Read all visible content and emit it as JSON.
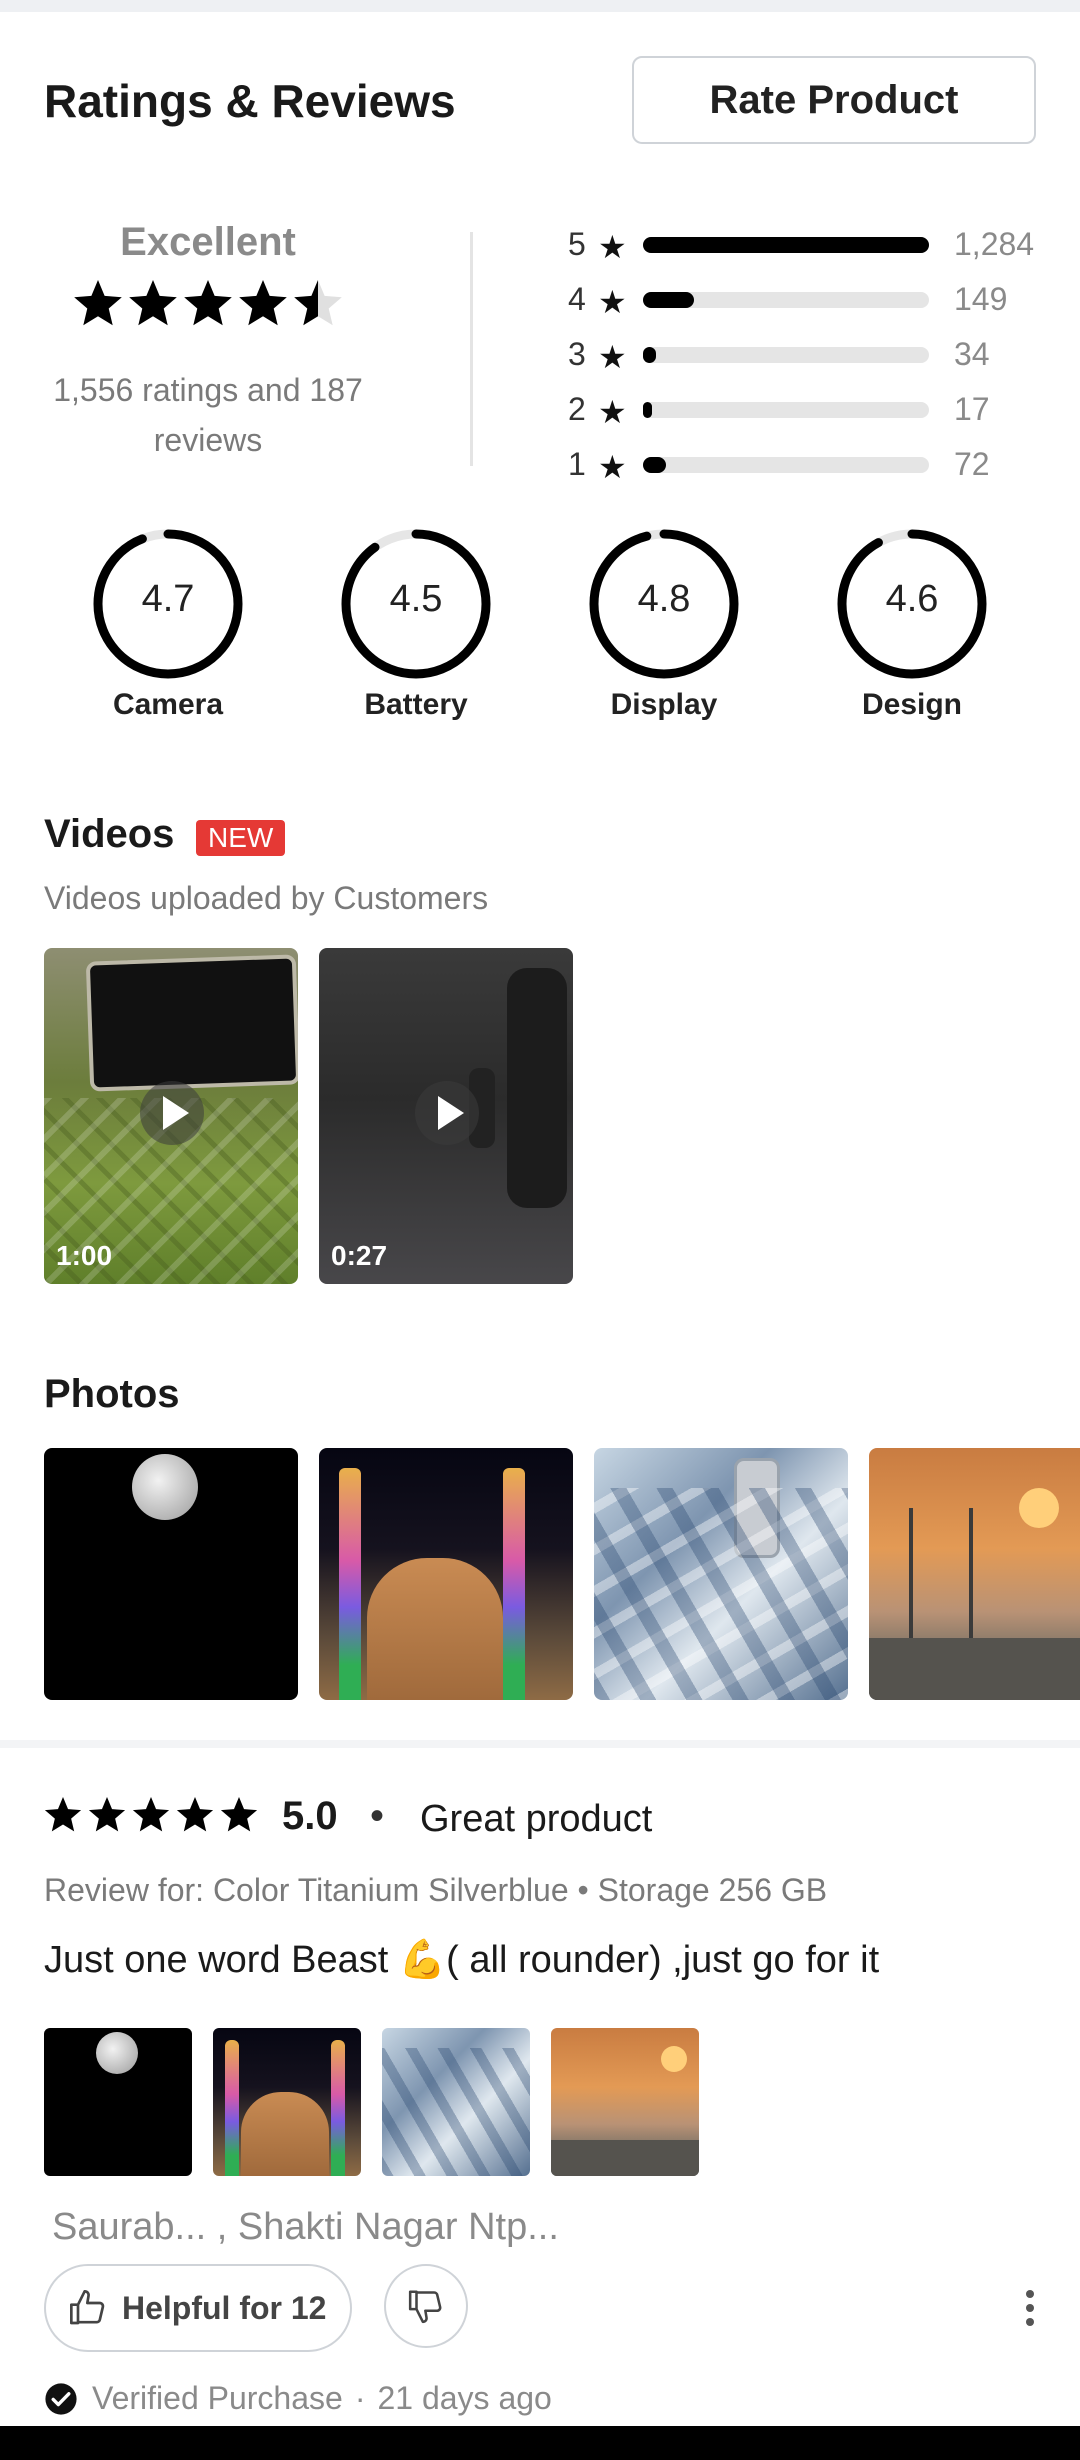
{
  "header": {
    "title": "Ratings & Reviews",
    "rate_button": "Rate Product"
  },
  "summary": {
    "label": "Excellent",
    "rating": 4.5,
    "count_text": "1,556 ratings and 187 reviews"
  },
  "distribution": [
    {
      "stars": "5",
      "count": "1,284",
      "fraction": 1.0
    },
    {
      "stars": "4",
      "count": "149",
      "fraction": 0.18
    },
    {
      "stars": "3",
      "count": "34",
      "fraction": 0.045
    },
    {
      "stars": "2",
      "count": "17",
      "fraction": 0.03
    },
    {
      "stars": "1",
      "count": "72",
      "fraction": 0.08
    }
  ],
  "star_glyph": "★",
  "aspects": [
    {
      "label": "Camera",
      "value": "4.7",
      "fraction": 0.94
    },
    {
      "label": "Battery",
      "value": "4.5",
      "fraction": 0.9
    },
    {
      "label": "Display",
      "value": "4.8",
      "fraction": 0.96
    },
    {
      "label": "Design",
      "value": "4.6",
      "fraction": 0.92
    }
  ],
  "videos": {
    "title": "Videos",
    "badge": "NEW",
    "subtitle": "Videos uploaded by Customers",
    "items": [
      {
        "duration": "1:00"
      },
      {
        "duration": "0:27"
      }
    ]
  },
  "photos": {
    "title": "Photos"
  },
  "review": {
    "rating": 5,
    "score": "5.0",
    "dot": "•",
    "headline": "Great product",
    "review_for": "Review for: Color Titanium Silverblue  •  Storage 256 GB",
    "text": "Just one word Beast 💪( all rounder) ,just go for it",
    "reviewer": "Saurab... , Shakti Nagar Ntp...",
    "helpful_label": "Helpful for 12",
    "verified_label": "Verified Purchase",
    "separator": "·",
    "posted": "21 days ago"
  },
  "colors": {
    "accent": "#000000",
    "badge": "#e53935",
    "muted": "#8a8a8a",
    "track": "#e5e5e5"
  }
}
